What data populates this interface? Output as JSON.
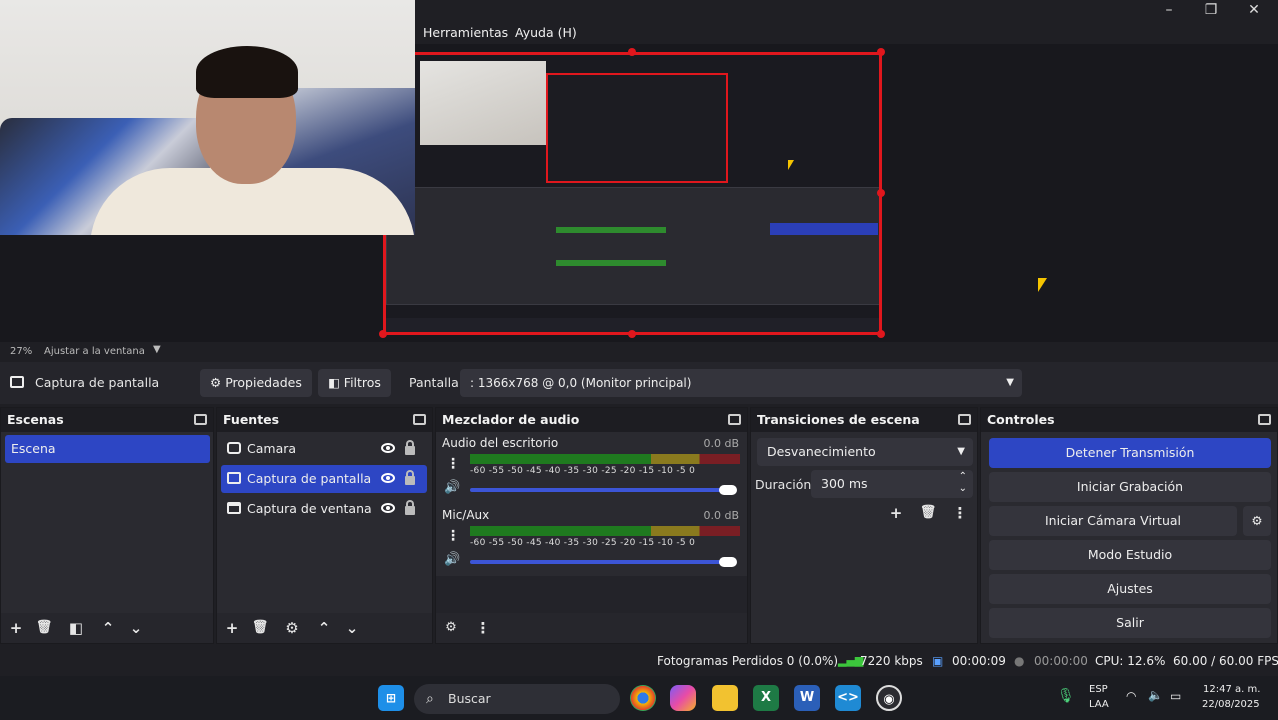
{
  "menu": {
    "tools": "Herramientas",
    "help": "Ayuda (H)"
  },
  "window_controls": {
    "minimize": "–",
    "maximize": "❐",
    "close": "✕"
  },
  "preview": {
    "zoom": "27%",
    "zoom_mode": "Ajustar a la ventana"
  },
  "source_toolbar": {
    "selected_source": "Captura de pantalla",
    "properties_label": "Propiedades",
    "filters_label": "Filtros",
    "display_label": "Pantalla",
    "display_value": ": 1366x768 @ 0,0 (Monitor principal)"
  },
  "scenes": {
    "title": "Escenas",
    "items": [
      "Escena"
    ]
  },
  "sources": {
    "title": "Fuentes",
    "items": [
      "Camara",
      "Captura de pantalla",
      "Captura de ventana"
    ]
  },
  "mixer": {
    "title": "Mezclador de audio",
    "channels": [
      {
        "name": "Audio del escritorio",
        "db": "0.0 dB",
        "volume": 1.0
      },
      {
        "name": "Mic/Aux",
        "db": "0.0 dB",
        "volume": 1.0
      }
    ],
    "ticks": "-60 -55 -50 -45 -40 -35 -30 -25 -20 -15 -10 -5 0"
  },
  "transitions": {
    "title": "Transiciones de escena",
    "selected": "Desvanecimiento",
    "duration_label": "Duración",
    "duration_value": "300 ms"
  },
  "controls": {
    "title": "Controles",
    "stop_streaming": "Detener Transmisión",
    "start_recording": "Iniciar Grabación",
    "start_virtual_camera": "Iniciar Cámara Virtual",
    "studio_mode": "Modo Estudio",
    "settings": "Ajustes",
    "exit": "Salir"
  },
  "status": {
    "dropped_frames": "Fotogramas Perdidos 0 (0.0%)",
    "bitrate": "7220 kbps",
    "stream_time": "00:00:09",
    "rec_time": "00:00:00",
    "cpu": "CPU: 12.6%",
    "fps": "60.00 / 60.00 FPS"
  },
  "taskbar": {
    "search_placeholder": "Buscar",
    "language_line1": "ESP",
    "language_line2": "LAA",
    "time": "12:47 a. m.",
    "date": "22/08/2025"
  },
  "colors": {
    "accent": "#2d46c4",
    "selection_border": "#e0171d",
    "panel_bg": "#2a2a30"
  }
}
